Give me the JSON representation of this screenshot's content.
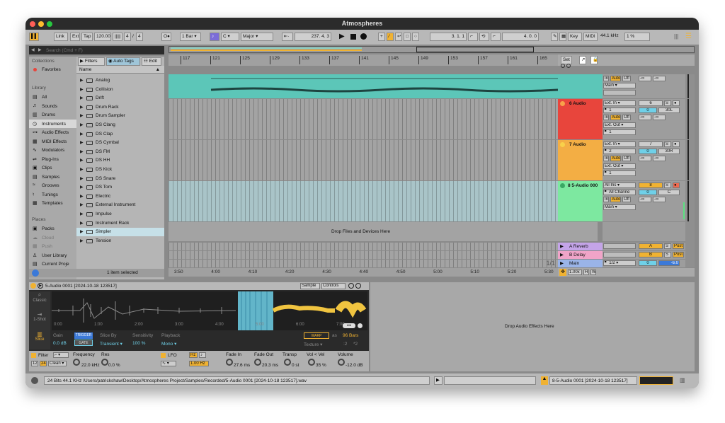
{
  "window": {
    "title": "Atmospheres"
  },
  "transport": {
    "link": "Link",
    "ext": "Ext",
    "tap": "Tap",
    "tempo": "120.00",
    "time_sig_a": "4",
    "time_sig_b": "4",
    "metro": "O●",
    "quant": "1 Bar",
    "key": "C",
    "scale": "Major",
    "arrangement_pos": "237.  4.  3",
    "loop_start": "3.  1.  1",
    "loop_length": "4.  0.  0",
    "key_map": "Key",
    "midi": "MIDI",
    "sample_rate": "44.1 kHz",
    "cpu": "1 %"
  },
  "browser": {
    "search_placeholder": "Search (Cmd + F)",
    "filters": "Filters",
    "auto_tags": "Auto Tags",
    "edit": "Edit",
    "collections_title": "Collections",
    "favorites": "Favorites",
    "library_title": "Library",
    "library_items": [
      {
        "icon": "all-icon",
        "label": "All"
      },
      {
        "icon": "sounds-icon",
        "label": "Sounds"
      },
      {
        "icon": "drums-icon",
        "label": "Drums"
      },
      {
        "icon": "instruments-icon",
        "label": "Instruments"
      },
      {
        "icon": "audio-effects-icon",
        "label": "Audio Effects"
      },
      {
        "icon": "midi-effects-icon",
        "label": "MIDI Effects"
      },
      {
        "icon": "modulators-icon",
        "label": "Modulators"
      },
      {
        "icon": "plugins-icon",
        "label": "Plug-Ins"
      },
      {
        "icon": "clips-icon",
        "label": "Clips"
      },
      {
        "icon": "samples-icon",
        "label": "Samples"
      },
      {
        "icon": "grooves-icon",
        "label": "Grooves"
      },
      {
        "icon": "tunings-icon",
        "label": "Tunings"
      },
      {
        "icon": "templates-icon",
        "label": "Templates"
      }
    ],
    "places_title": "Places",
    "places_items": [
      "Packs",
      "Cloud",
      "Push",
      "User Library",
      "Current Proje",
      "Add Folder..."
    ],
    "column_name": "Name",
    "files": [
      "Analog",
      "Collision",
      "Drift",
      "Drum Rack",
      "Drum Sampler",
      "DS Clang",
      "DS Clap",
      "DS Cymbal",
      "DS FM",
      "DS HH",
      "DS Kick",
      "DS Snare",
      "DS Tom",
      "Electric",
      "External Instrument",
      "Impulse",
      "Instrument Rack",
      "Simpler",
      "Tension"
    ],
    "status": "1 item selected"
  },
  "ruler": {
    "bars": [
      "117",
      "121",
      "125",
      "129",
      "133",
      "137",
      "141",
      "145",
      "149",
      "153",
      "157",
      "161",
      "165"
    ]
  },
  "timeline": {
    "times": [
      "3:50",
      "4:00",
      "4:10",
      "4:20",
      "4:30",
      "4:40",
      "4:50",
      "5:00",
      "5:10",
      "5:20",
      "5:30"
    ],
    "page": "1/1"
  },
  "arrangement": {
    "set": "Set",
    "drop_files": "Drop Files and Devices Here",
    "zoom": "1.00x",
    "h": "H",
    "w": "W"
  },
  "tracks": [
    {
      "name": "",
      "color": "#5cc6b8",
      "io_in": "",
      "in": "In",
      "auto": "Auto",
      "off": "Off",
      "vol": "-∞",
      "pan": "-∞",
      "out": "Main",
      "num": "",
      "s": ""
    },
    {
      "name": "6 Audio",
      "color": "#e8453c",
      "io_in": "Ext. In",
      "ch": "1",
      "in": "In",
      "auto": "Auto",
      "off": "Off",
      "vol": "-∞",
      "pan": "-∞",
      "out": "Ext. Out",
      "out_ch": "1",
      "num": "6",
      "s": "S",
      "db": "0",
      "panv": "30L"
    },
    {
      "name": "7 Audio",
      "color": "#f3ae44",
      "io_in": "Ext. In",
      "ch": "2",
      "in": "In",
      "auto": "Auto",
      "off": "Off",
      "vol": "-∞",
      "pan": "-∞",
      "out": "Ext. Out",
      "out_ch": "1",
      "num": "7",
      "s": "S",
      "db": "0",
      "panv": "30R"
    },
    {
      "name": "8 5-Audio 000",
      "color": "#7de8a0",
      "io_in": "All Ins",
      "ch": "All Channe",
      "in": "In",
      "auto": "Auto",
      "off": "Off",
      "vol": "-∞",
      "pan": "-∞",
      "out": "Main",
      "num": "8",
      "s": "S",
      "db": "0",
      "panv": "C"
    }
  ],
  "returns": [
    {
      "name": "A Reverb",
      "color": "#c4a4e8",
      "letter": "A",
      "s": "S",
      "post": "Post"
    },
    {
      "name": "B Delay",
      "color": "#f0a4c8",
      "letter": "B",
      "s": "S",
      "post": "Post"
    },
    {
      "name": "Main",
      "color": "#9ab4e8",
      "ch": "1/2",
      "vol": "0",
      "db": "-6.0"
    }
  ],
  "clip": {
    "title": "5-Audio 0001 [2024-10-18 123517]",
    "tab_sample": "Sample",
    "tab_controls": "Controls",
    "mode_classic": "Classic",
    "mode_oneshot": "1-Shot",
    "mode_slice": "Slice",
    "times": [
      "0:00",
      "1:00",
      "2:00",
      "3:00",
      "4:00",
      "5:00",
      "6:00",
      "7:00"
    ],
    "gain_label": "Gain",
    "gain": "0.0 dB",
    "trigger": "TRIGGER",
    "gate": "GATE",
    "slice_by_label": "Slice By",
    "slice_by": "Transient",
    "sensitivity_label": "Sensitivity",
    "sensitivity": "100 %",
    "playback_label": "Playback",
    "playback": "Mono",
    "warp": "WARP",
    "as": "as",
    "bars": "96 Bars",
    "texture": "Texture",
    "half": ":2",
    "double": "*2",
    "filter_label": "Filter",
    "filter_a": "12",
    "filter_b": "24",
    "filter_type": "Clean",
    "freq_label": "Frequency",
    "freq": "22.0 kHz",
    "res_label": "Res",
    "res": "0.0 %",
    "lfo_label": "LFO",
    "hz_label": "Hz",
    "lfo_rate": "1.00 Hz",
    "fade_in_label": "Fade In",
    "fade_in": "27.6 ms",
    "fade_out_label": "Fade Out",
    "fade_out": "20.3 ms",
    "transp_label": "Transp",
    "transp": "0 st",
    "volvel_label": "Vol < Vel",
    "volvel": "35 %",
    "volume_label": "Volume",
    "volume": "-12.0 dB",
    "drop_effects": "Drop Audio Effects Here"
  },
  "statusbar": {
    "path": "24 Bits 44.1 KHz /Users/patrickshaw/Desktop/Atmospheres Project/Samples/Recorded/5-Audio 0001 [2024-10-18 123517].wav",
    "clip": "8-5-Audio 0001 [2024-10-18 123517]"
  },
  "colors": {
    "accent": "#f0b232",
    "teal_clip": "#5cc6b8",
    "cyan": "#6fd0e8"
  }
}
